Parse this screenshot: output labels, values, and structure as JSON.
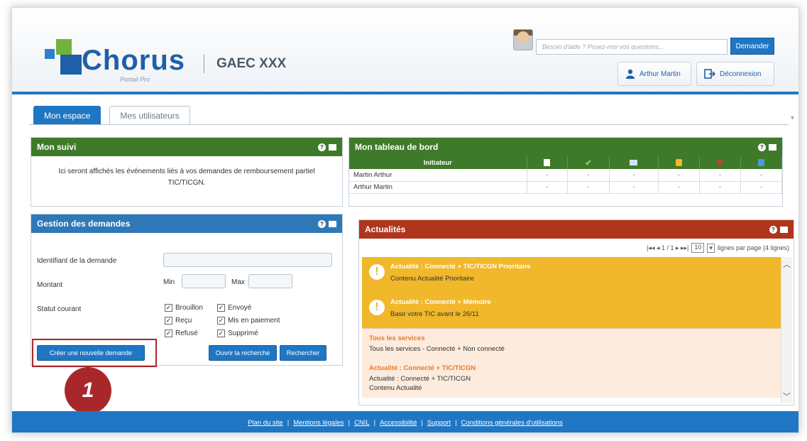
{
  "header": {
    "logo_text": "Chorus",
    "logo_sub": "Portail Pro",
    "organization": "GAEC XXX",
    "help_placeholder": "Besoin d'aide ? Posez-moi vos questions...",
    "help_button": "Demander",
    "user_name": "Arthur Martin",
    "logout": "Déconnexion"
  },
  "tabs": [
    {
      "label": "Mon espace",
      "active": true
    },
    {
      "label": "Mes utilisateurs",
      "active": false
    }
  ],
  "suivi": {
    "title": "Mon suivi",
    "message": "Ici seront affichés les événements liés à vos demandes de remboursement partiel TIC/TICGN."
  },
  "tableau": {
    "title": "Mon tableau de bord",
    "header_initiateur": "Initiateur",
    "status_icons": [
      "document-icon",
      "check-icon",
      "mail-icon",
      "money-icon",
      "cross-icon",
      "trash-icon"
    ],
    "rows": [
      {
        "name": "Martin Arthur",
        "values": [
          "-",
          "-",
          "-",
          "-",
          "-",
          "-"
        ]
      },
      {
        "name": "Arthur Martin",
        "values": [
          "-",
          "-",
          "-",
          "-",
          "-",
          "-"
        ]
      }
    ]
  },
  "gestion": {
    "title": "Gestion des demandes",
    "identifiant_label": "Identifiant de la demande",
    "montant_label": "Montant",
    "min_label": "Min",
    "max_label": "Max",
    "statut_label": "Statut courant",
    "statuts": [
      "Brouillon",
      "Envoyé",
      "Reçu",
      "Mis en paiement",
      "Refusé",
      "Supprimé"
    ],
    "create_button": "Créer une nouvelle demande",
    "open_search_button": "Ouvrir la recherche",
    "search_button": "Rechercher"
  },
  "badge_number": "1",
  "actualites": {
    "title": "Actualités",
    "pager_text": "|◂◂ ◂ 1 / 1 ▸ ▸▸|",
    "per_page_value": "10",
    "per_page_label": "lignes par page (4 lignes)",
    "items": [
      {
        "title": "Actualité : Connecté + TIC/TICGN Prioritaire",
        "body": "Contenu Actualité Prioritaire"
      },
      {
        "title": "Actualité : Connecté + Mémoire",
        "body": "Basir votre TIC avant le 26/11"
      },
      {
        "title": "Tous les services",
        "body": "Tous les services - Connecté + Non connecté"
      },
      {
        "title": "Actualité : Connecté + TIC/TICGN",
        "body": "Actualité : Connecté + TIC/TICGN",
        "body2": "Contenu Actualité"
      }
    ]
  },
  "footer": {
    "links": [
      "Plan du site",
      "Mentions légales",
      "CNIL",
      "Accessibilité",
      "Support",
      "Conditions générales d'utilisations"
    ]
  },
  "colors": {
    "brand_blue": "#1f77c4",
    "green_header": "#3f7a2a",
    "red_header": "#b0351d",
    "yellow_news": "#f0b82a",
    "badge_red": "#a8272b"
  }
}
